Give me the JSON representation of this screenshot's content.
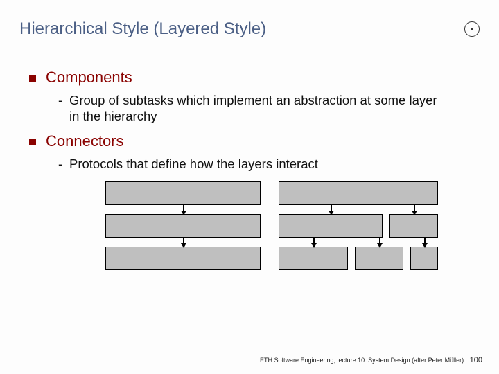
{
  "title": "Hierarchical Style (Layered Style)",
  "sections": [
    {
      "heading": "Components",
      "sub": "Group of subtasks which implement an abstraction at some layer in the hierarchy"
    },
    {
      "heading": "Connectors",
      "sub": "Protocols that define how the layers interact"
    }
  ],
  "footer": {
    "text": "ETH Software Engineering, lecture 10: System Design (after Peter Müller)",
    "page": "100"
  }
}
